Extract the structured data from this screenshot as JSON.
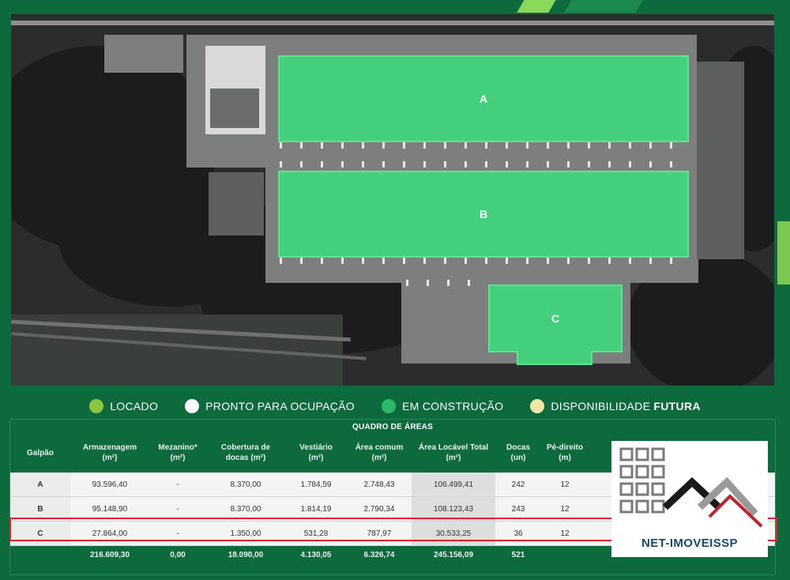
{
  "buildings": {
    "a": {
      "label": "A",
      "color": "#43cf7c"
    },
    "b": {
      "label": "B",
      "color": "#43cf7c"
    },
    "c": {
      "label": "C",
      "color": "#43cf7c"
    }
  },
  "legend": [
    {
      "label": "LOCADO",
      "color": "#8cc63f"
    },
    {
      "label": "PRONTO PARA OCUPAÇÃO",
      "color": "#ffffff"
    },
    {
      "label": "EM CONSTRUÇÃO",
      "color": "#2bb868"
    },
    {
      "label": "DISPONIBILIDADE",
      "label_bold": "FUTURA",
      "color": "#f2e5a8"
    }
  ],
  "table": {
    "title": "QUADRO DE ÁREAS",
    "headers": [
      {
        "line1": "Galpão",
        "line2": ""
      },
      {
        "line1": "Armazenagem",
        "line2": "(m²)"
      },
      {
        "line1": "Mezanino*",
        "line2": "(m²)"
      },
      {
        "line1": "Cobertura de",
        "line2": "docas (m²)"
      },
      {
        "line1": "Vestiário",
        "line2": "(m²)"
      },
      {
        "line1": "Área comum",
        "line2": "(m²)"
      },
      {
        "line1": "Área Locável Total",
        "line2": "(m²)"
      },
      {
        "line1": "Docas",
        "line2": "(un)"
      },
      {
        "line1": "Pé-direito",
        "line2": "(m)"
      }
    ],
    "rows": [
      [
        "A",
        "93.596,40",
        "-",
        "8.370,00",
        "1.784,59",
        "2.748,43",
        "106.499,41",
        "242",
        "12"
      ],
      [
        "B",
        "95.148,90",
        "-",
        "8.370,00",
        "1.814,19",
        "2.790,34",
        "108.123,43",
        "243",
        "12"
      ],
      [
        "C",
        "27.864,00",
        "-",
        "1.350,00",
        "531,28",
        "787,97",
        "30.533,25",
        "36",
        "12"
      ]
    ],
    "total": [
      "",
      "216.609,30",
      "0,00",
      "18.090,00",
      "4.130,05",
      "6.326,74",
      "245.156,09",
      "521",
      ""
    ]
  },
  "logo": {
    "text": "NET-IMOVEISSP",
    "color": "#174a6e",
    "accent": "#c0242b"
  }
}
